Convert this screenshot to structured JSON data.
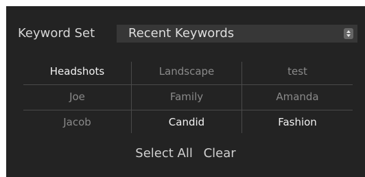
{
  "keyword_set": {
    "label": "Keyword Set",
    "selected": "Recent Keywords"
  },
  "keywords": [
    [
      {
        "label": "Headshots",
        "active": true
      },
      {
        "label": "Landscape",
        "active": false
      },
      {
        "label": "test",
        "active": false
      }
    ],
    [
      {
        "label": "Joe",
        "active": false
      },
      {
        "label": "Family",
        "active": false
      },
      {
        "label": "Amanda",
        "active": false
      }
    ],
    [
      {
        "label": "Jacob",
        "active": false
      },
      {
        "label": "Candid",
        "active": true
      },
      {
        "label": "Fashion",
        "active": true
      }
    ]
  ],
  "actions": {
    "select_all": "Select All",
    "clear": "Clear"
  },
  "colors": {
    "panel_bg": "#232323",
    "select_bg": "#373737",
    "active_text": "#f2f2f2",
    "inactive_text": "#8a8a8a"
  }
}
